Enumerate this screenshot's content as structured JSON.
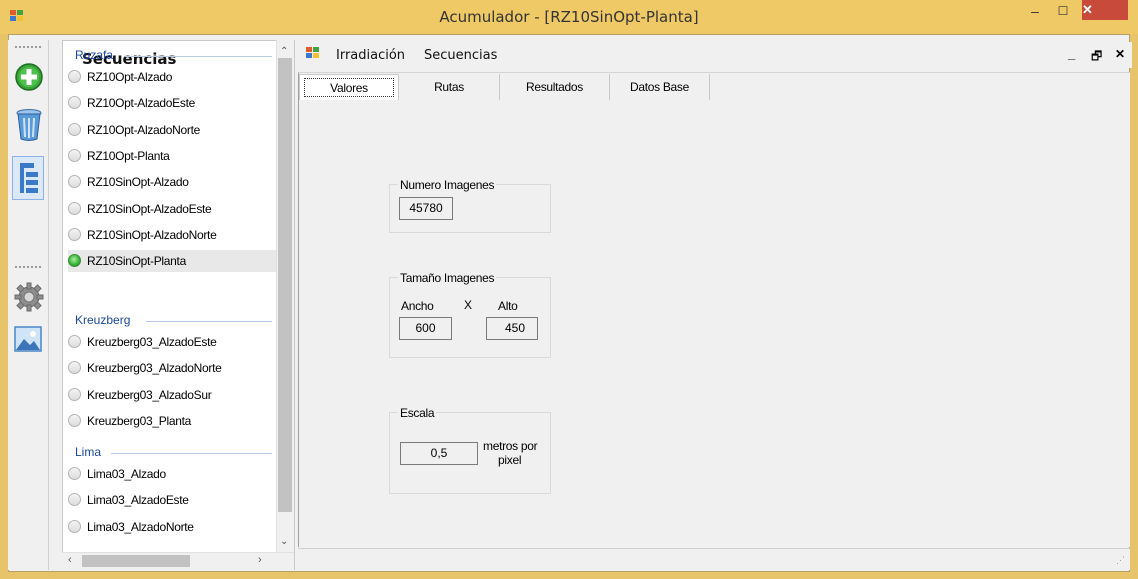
{
  "window": {
    "title": "Acumulador - [RZ10SinOpt-Planta]",
    "minimize": "–",
    "maximize": "☐",
    "close": "✕"
  },
  "toolbar": {
    "items": [
      "add-icon",
      "trash-icon",
      "tree-icon",
      "gear-icon",
      "image-icon"
    ]
  },
  "sequences": {
    "title": "Secuencias",
    "groups": [
      {
        "name": "Ruzafa",
        "items": [
          {
            "label": "RZ10Opt-Alzado",
            "selected": false
          },
          {
            "label": "RZ10Opt-AlzadoEste",
            "selected": false
          },
          {
            "label": "RZ10Opt-AlzadoNorte",
            "selected": false
          },
          {
            "label": "RZ10Opt-Planta",
            "selected": false
          },
          {
            "label": "RZ10SinOpt-Alzado",
            "selected": false
          },
          {
            "label": "RZ10SinOpt-AlzadoEste",
            "selected": false
          },
          {
            "label": "RZ10SinOpt-AlzadoNorte",
            "selected": false
          },
          {
            "label": "RZ10SinOpt-Planta",
            "selected": true
          }
        ]
      },
      {
        "name": "Kreuzberg",
        "items": [
          {
            "label": "Kreuzberg03_AlzadoEste",
            "selected": false
          },
          {
            "label": "Kreuzberg03_AlzadoNorte",
            "selected": false
          },
          {
            "label": "Kreuzberg03_AlzadoSur",
            "selected": false
          },
          {
            "label": "Kreuzberg03_Planta",
            "selected": false
          }
        ]
      },
      {
        "name": "Lima",
        "items": [
          {
            "label": "Lima03_Alzado",
            "selected": false
          },
          {
            "label": "Lima03_AlzadoEste",
            "selected": false
          },
          {
            "label": "Lima03_AlzadoNorte",
            "selected": false
          }
        ]
      }
    ]
  },
  "menu": {
    "items": [
      "Irradiación",
      "Secuencias"
    ],
    "child_minimize": "_",
    "child_restore": "🗗",
    "child_close": "✕"
  },
  "tabs": [
    "Valores",
    "Rutas",
    "Resultados",
    "Datos Base"
  ],
  "valores": {
    "numero_imagenes": {
      "title": "Numero Imagenes",
      "value": "45780"
    },
    "tamano_imagenes": {
      "title": "Tamaño Imagenes",
      "ancho_label": "Ancho",
      "x_label": "X",
      "alto_label": "Alto",
      "ancho": "600",
      "alto": "450"
    },
    "escala": {
      "title": "Escala",
      "value": "0,5",
      "unit_line1": "metros por",
      "unit_line2": "pixel"
    }
  },
  "colors": {
    "title_bar": "#f0c967",
    "close_button": "#c74a3b",
    "group_label": "#1a48a0"
  }
}
